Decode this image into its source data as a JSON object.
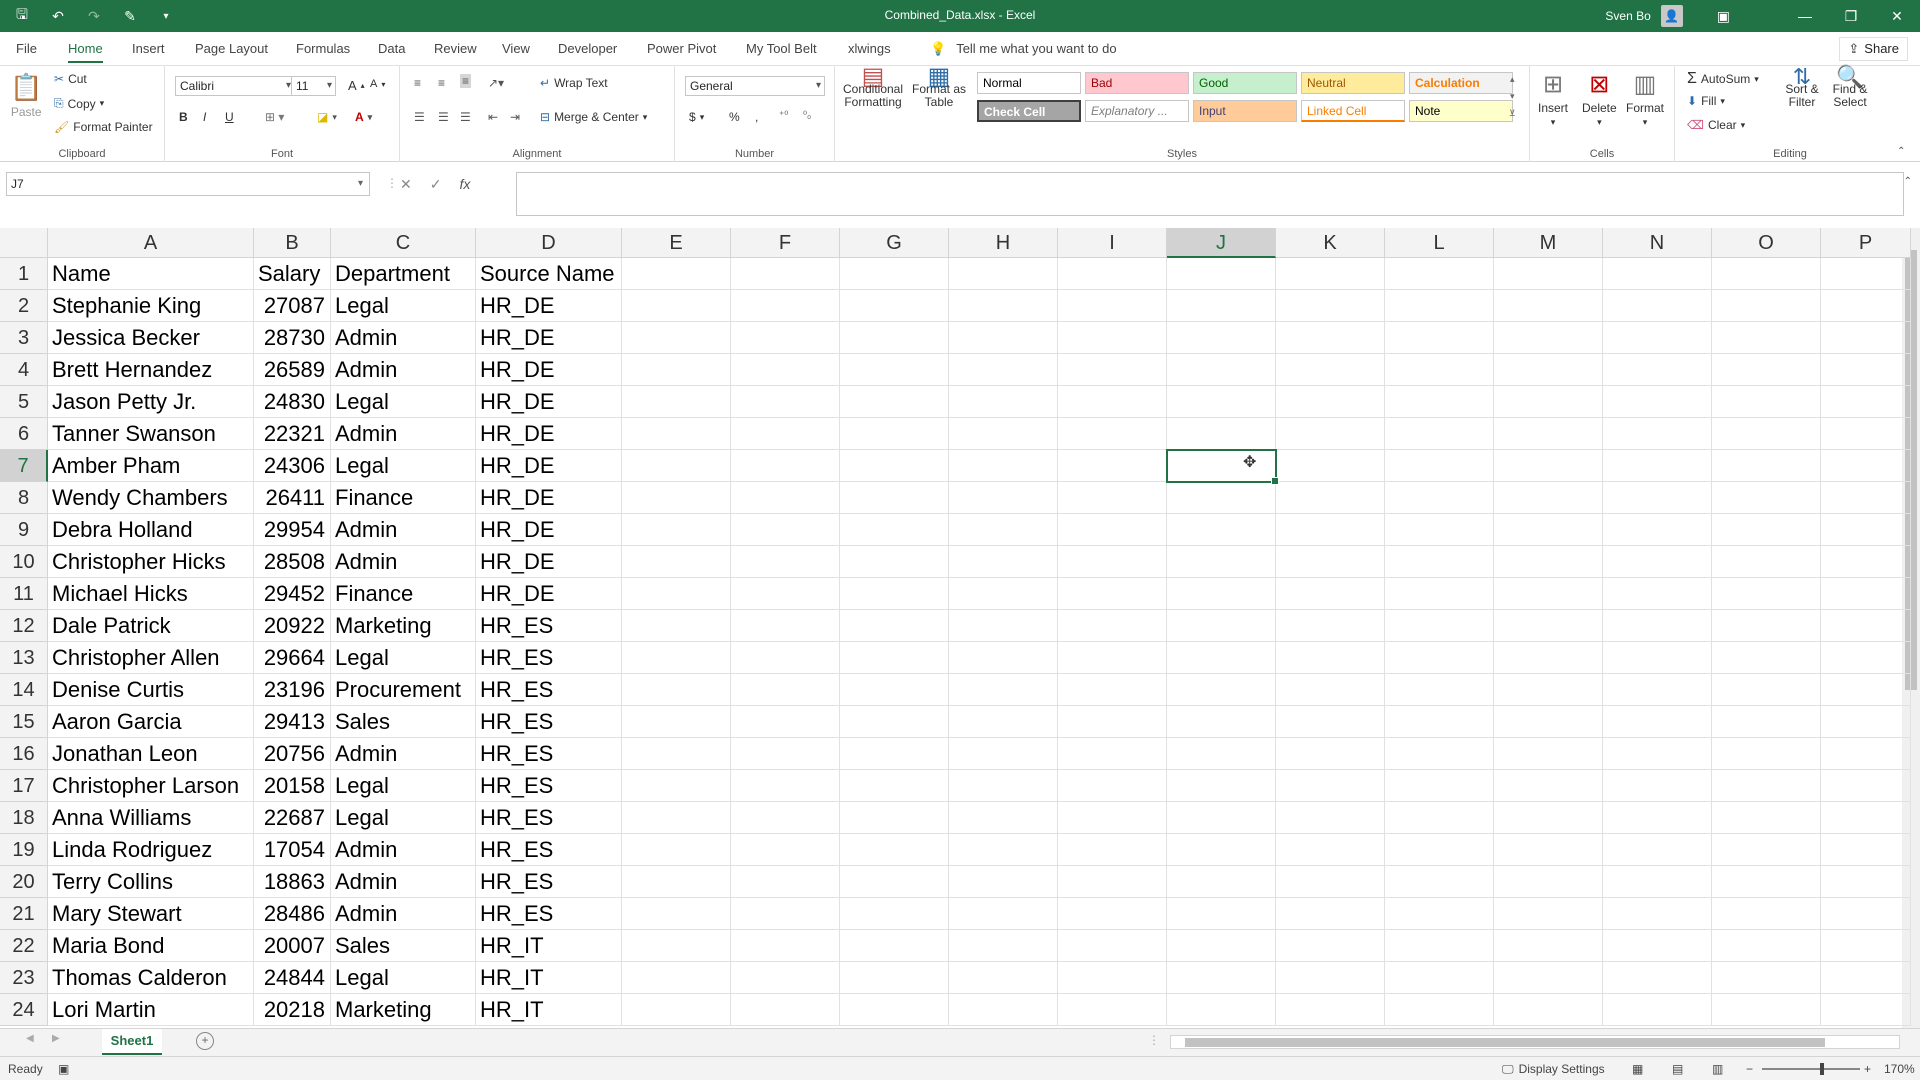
{
  "window": {
    "title": "Combined_Data.xlsx  -  Excel",
    "user_name": "Sven Bo",
    "controls": [
      "—",
      "❐",
      "✕"
    ]
  },
  "qat": {
    "save": "save-icon",
    "undo": "undo-icon",
    "redo": "redo-icon",
    "brush": "brush-icon"
  },
  "tabs": [
    "File",
    "Home",
    "Insert",
    "Page Layout",
    "Formulas",
    "Data",
    "Review",
    "View",
    "Developer",
    "Power Pivot",
    "My Tool Belt",
    "xlwings"
  ],
  "active_tab": "Home",
  "tell_me": "Tell me what you want to do",
  "share": "Share",
  "ribbon": {
    "clipboard": {
      "label": "Clipboard",
      "paste": "Paste",
      "cut": "Cut",
      "copy": "Copy",
      "format_painter": "Format Painter"
    },
    "font": {
      "label": "Font",
      "font_name": "Calibri",
      "font_size": "11",
      "bold": "B",
      "italic": "I",
      "underline": "U"
    },
    "alignment": {
      "label": "Alignment",
      "wrap_text": "Wrap Text",
      "merge_center": "Merge & Center"
    },
    "number": {
      "label": "Number",
      "format": "General",
      "currency": "$",
      "percent": "%",
      "comma": ","
    },
    "styles": {
      "label": "Styles",
      "conditional_formatting": "Conditional Formatting",
      "format_as_table": "Format as Table",
      "cells": [
        {
          "name": "Normal",
          "bg": "#ffffff",
          "fg": "#000000"
        },
        {
          "name": "Bad",
          "bg": "#ffc7ce",
          "fg": "#9c0006"
        },
        {
          "name": "Good",
          "bg": "#c6efce",
          "fg": "#006100"
        },
        {
          "name": "Neutral",
          "bg": "#ffeb9c",
          "fg": "#9c5700"
        },
        {
          "name": "Calculation",
          "bg": "#f2f2f2",
          "fg": "#fa7d00"
        },
        {
          "name": "Check Cell",
          "bg": "#a5a5a5",
          "fg": "#ffffff"
        },
        {
          "name": "Explanatory ...",
          "bg": "#ffffff",
          "fg": "#7f7f7f"
        },
        {
          "name": "Input",
          "bg": "#ffcc99",
          "fg": "#3f3f76"
        },
        {
          "name": "Linked Cell",
          "bg": "#ffffff",
          "fg": "#fa7d00"
        },
        {
          "name": "Note",
          "bg": "#ffffcc",
          "fg": "#000000"
        }
      ]
    },
    "cells": {
      "label": "Cells",
      "insert": "Insert",
      "delete": "Delete",
      "format": "Format"
    },
    "editing": {
      "label": "Editing",
      "autosum": "AutoSum",
      "fill": "Fill",
      "clear": "Clear",
      "sort_filter": "Sort & Filter",
      "find_select": "Find & Select"
    }
  },
  "formula_bar": {
    "name_box": "J7",
    "cancel": "✕",
    "enter": "✓",
    "fx": "fx",
    "formula": ""
  },
  "sheet": {
    "columns": [
      "A",
      "B",
      "C",
      "D",
      "E",
      "F",
      "G",
      "H",
      "I",
      "J",
      "K",
      "L",
      "M",
      "N",
      "O",
      "P"
    ],
    "selected_col": "J",
    "selected_row": 7,
    "rows": [
      [
        "Name",
        "Salary",
        "Department",
        "Source Name"
      ],
      [
        "Stephanie King",
        "27087",
        "Legal",
        "HR_DE"
      ],
      [
        "Jessica Becker",
        "28730",
        "Admin",
        "HR_DE"
      ],
      [
        "Brett Hernandez",
        "26589",
        "Admin",
        "HR_DE"
      ],
      [
        "Jason Petty Jr.",
        "24830",
        "Legal",
        "HR_DE"
      ],
      [
        "Tanner Swanson",
        "22321",
        "Admin",
        "HR_DE"
      ],
      [
        "Amber Pham",
        "24306",
        "Legal",
        "HR_DE"
      ],
      [
        "Wendy Chambers",
        "26411",
        "Finance",
        "HR_DE"
      ],
      [
        "Debra Holland",
        "29954",
        "Admin",
        "HR_DE"
      ],
      [
        "Christopher Hicks",
        "28508",
        "Admin",
        "HR_DE"
      ],
      [
        "Michael Hicks",
        "29452",
        "Finance",
        "HR_DE"
      ],
      [
        "Dale Patrick",
        "20922",
        "Marketing",
        "HR_ES"
      ],
      [
        "Christopher Allen",
        "29664",
        "Legal",
        "HR_ES"
      ],
      [
        "Denise Curtis",
        "23196",
        "Procurement",
        "HR_ES"
      ],
      [
        "Aaron Garcia",
        "29413",
        "Sales",
        "HR_ES"
      ],
      [
        "Jonathan Leon",
        "20756",
        "Admin",
        "HR_ES"
      ],
      [
        "Christopher Larson",
        "20158",
        "Legal",
        "HR_ES"
      ],
      [
        "Anna Williams",
        "22687",
        "Legal",
        "HR_ES"
      ],
      [
        "Linda Rodriguez",
        "17054",
        "Admin",
        "HR_ES"
      ],
      [
        "Terry Collins",
        "18863",
        "Admin",
        "HR_ES"
      ],
      [
        "Mary Stewart",
        "28486",
        "Admin",
        "HR_ES"
      ],
      [
        "Maria Bond",
        "20007",
        "Sales",
        "HR_IT"
      ],
      [
        "Thomas Calderon",
        "24844",
        "Legal",
        "HR_IT"
      ],
      [
        "Lori Martin",
        "20218",
        "Marketing",
        "HR_IT"
      ]
    ]
  },
  "sheet_tabs": [
    "Sheet1"
  ],
  "status": {
    "ready": "Ready",
    "display_settings": "Display Settings",
    "zoom": "170%"
  },
  "colors": {
    "accent": "#217346"
  }
}
